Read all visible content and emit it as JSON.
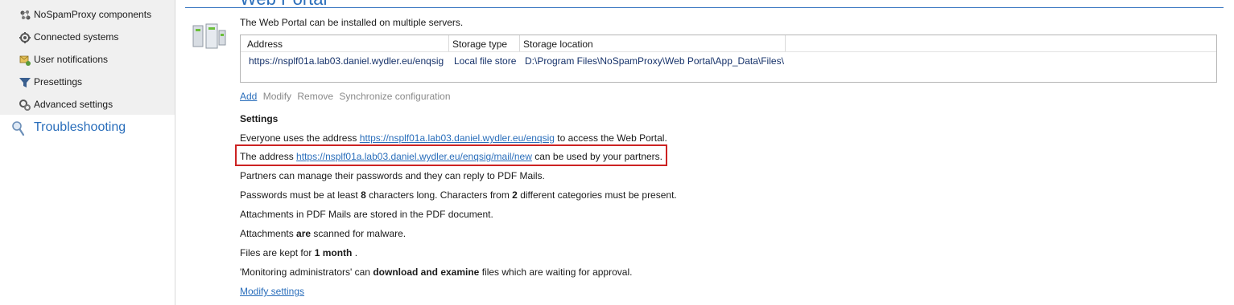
{
  "sidebar": {
    "items": [
      {
        "label": "NoSpamProxy components",
        "icon": "components-icon"
      },
      {
        "label": "Connected systems",
        "icon": "connected-systems-icon"
      },
      {
        "label": "User notifications",
        "icon": "user-notifications-icon"
      },
      {
        "label": "Presettings",
        "icon": "funnel-icon"
      },
      {
        "label": "Advanced settings",
        "icon": "advanced-settings-icon"
      }
    ],
    "troubleshooting": "Troubleshooting"
  },
  "main": {
    "title": "Web Portal",
    "intro": "The Web Portal can be installed on multiple servers.",
    "table": {
      "columns": [
        "Address",
        "Storage type",
        "Storage location"
      ],
      "rows": [
        [
          "https://nsplf01a.lab03.daniel.wydler.eu/enqsig",
          "Local file store",
          "D:\\Program Files\\NoSpamProxy\\Web Portal\\App_Data\\Files\\"
        ]
      ]
    },
    "actions": {
      "add": "Add",
      "modify": "Modify",
      "remove": "Remove",
      "sync": "Synchronize configuration"
    },
    "settings": {
      "title": "Settings",
      "line1_pre": "Everyone uses the address ",
      "line1_link": "https://nsplf01a.lab03.daniel.wydler.eu/enqsig",
      "line1_post": " to access the Web Portal.",
      "line2_pre": "The address ",
      "line2_link": "https://nsplf01a.lab03.daniel.wydler.eu/enqsig/mail/new",
      "line2_post": " can be used by your partners.",
      "line3": "Partners can manage their passwords and they can reply to PDF Mails.",
      "line4_a": "Passwords must be at least ",
      "line4_b": "8",
      "line4_c": " characters long. Characters from ",
      "line4_d": "2",
      "line4_e": " different categories must be present.",
      "line5": "Attachments in PDF Mails are stored in the PDF document.",
      "line6_a": "Attachments ",
      "line6_b": "are",
      "line6_c": " scanned for malware.",
      "line7_a": "Files are kept for ",
      "line7_b": "1 month",
      "line7_c": " .",
      "line8_a": "'Monitoring administrators' can ",
      "line8_b": "download and examine",
      "line8_c": " files which are waiting for approval.",
      "modify_link": "Modify settings"
    },
    "colors": {
      "accent": "#2a6ebb",
      "highlight_border": "#cc2222"
    }
  }
}
